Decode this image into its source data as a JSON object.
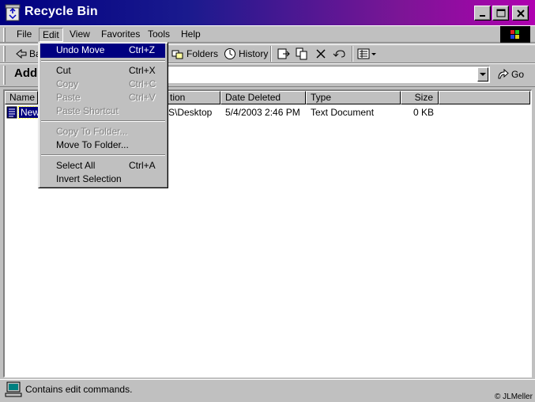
{
  "window": {
    "title": "Recycle Bin"
  },
  "menu": {
    "file": "File",
    "edit": "Edit",
    "view": "View",
    "favorites": "Favorites",
    "tools": "Tools",
    "help": "Help"
  },
  "toolbar": {
    "back": "Ba",
    "folders": "Folders",
    "history": "History"
  },
  "address": {
    "label": "Addr"
  },
  "go": {
    "label": "Go"
  },
  "columns": {
    "name": "Name",
    "location": "tion",
    "date_deleted": "Date Deleted",
    "type": "Type",
    "size": "Size"
  },
  "file_row": {
    "name": "New",
    "location": "S\\Desktop",
    "date_deleted": "5/4/2003 2:46 PM",
    "type": "Text Document",
    "size": "0 KB"
  },
  "edit_menu": {
    "undo": {
      "label": "Undo Move",
      "shortcut": "Ctrl+Z",
      "enabled": true
    },
    "cut": {
      "label": "Cut",
      "shortcut": "Ctrl+X",
      "enabled": true
    },
    "copy": {
      "label": "Copy",
      "shortcut": "Ctrl+C",
      "enabled": false
    },
    "paste": {
      "label": "Paste",
      "shortcut": "Ctrl+V",
      "enabled": false
    },
    "paste_shortcut": {
      "label": "Paste Shortcut",
      "enabled": false
    },
    "copy_to_folder": {
      "label": "Copy To Folder...",
      "enabled": false
    },
    "move_to_folder": {
      "label": "Move To Folder...",
      "enabled": true
    },
    "select_all": {
      "label": "Select All",
      "shortcut": "Ctrl+A",
      "enabled": true
    },
    "invert_selection": {
      "label": "Invert Selection",
      "enabled": true
    }
  },
  "status": {
    "text": "Contains edit commands."
  },
  "watermark": {
    "text": "© JLMeller"
  },
  "colors": {
    "titlebar_start": "#000080",
    "titlebar_end": "#b000b0",
    "selection": "#000080",
    "face": "#c0c0c0"
  }
}
